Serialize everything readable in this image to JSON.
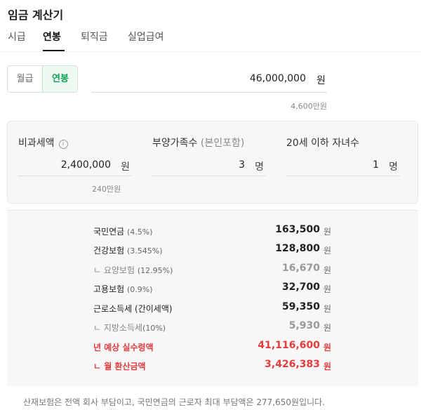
{
  "title": "임금 계산기",
  "tabs": [
    {
      "label": "시급"
    },
    {
      "label": "연봉"
    },
    {
      "label": "퇴직금"
    },
    {
      "label": "실업급여"
    }
  ],
  "active_tab": "연봉",
  "segment": {
    "monthly": "월급",
    "annual": "연봉",
    "selected": "연봉"
  },
  "salary": {
    "value": "46,000,000",
    "unit": "원",
    "hint": "4,600만원"
  },
  "inputs": {
    "nontax": {
      "label": "비과세액",
      "value": "2,400,000",
      "unit": "원",
      "hint": "240만원"
    },
    "dependents": {
      "label": "부양가족수",
      "sub": "(본인포함)",
      "value": "3",
      "unit": "명"
    },
    "children": {
      "label": "20세 이하 자녀수",
      "value": "1",
      "unit": "명"
    }
  },
  "results": [
    {
      "label": "국민연금",
      "pct": "(4.5%)",
      "value": "163,500",
      "unit": "원"
    },
    {
      "label": "건강보험",
      "pct": "(3.545%)",
      "value": "128,800",
      "unit": "원"
    },
    {
      "label": "ㄴ 요양보험",
      "pct": "(12.95%)",
      "value": "16,670",
      "unit": "원"
    },
    {
      "label": "고용보험",
      "pct": "(0.9%)",
      "value": "32,700",
      "unit": "원"
    },
    {
      "label": "근로소득세",
      "pct": "(간이세액)",
      "value": "59,350",
      "unit": "원"
    },
    {
      "label": "ㄴ 지방소득세",
      "pct": "(10%)",
      "value": "5,930",
      "unit": "원"
    },
    {
      "label": "년 예상 실수령액",
      "pct": "",
      "value": "41,116,600",
      "unit": "원"
    },
    {
      "label": "ㄴ 월 환산금액",
      "pct": "",
      "value": "3,426,383",
      "unit": "원"
    }
  ],
  "note": "산재보험은 전액 회사 부담이고, 국민연금의 근로자 최대 부담액은 277,650원입니다.",
  "colors": {
    "accent_green": "#13a05a",
    "highlight_red": "#e33c3c"
  }
}
